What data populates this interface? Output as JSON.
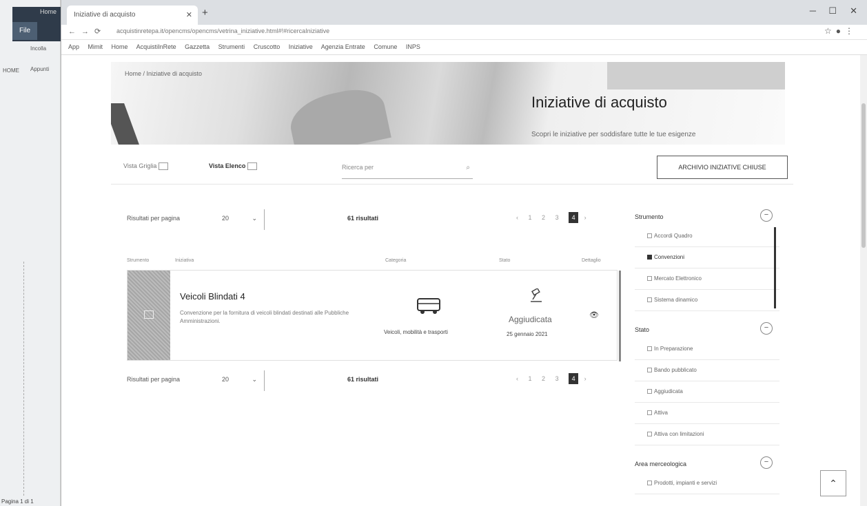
{
  "left_app": {
    "file_tab": "File",
    "home_tab": "Home",
    "side_texts": [
      "Incolla",
      "Appunti",
      "HOME"
    ],
    "status": "Pagina 1 di 1"
  },
  "browser": {
    "tab_title": "Iniziative di acquisto",
    "url": "acquistinretepa.it/opencms/opencms/vetrina_iniziative.html#!#ricercaIniziative",
    "bookmarks": [
      "App",
      "Mimit",
      "Home",
      "AcquistiInRete",
      "Gazzetta",
      "Strumenti",
      "Cruscotto",
      "Iniziative",
      "Agenzia Entrate",
      "Comune",
      "INPS"
    ]
  },
  "page": {
    "breadcrumb": "Home / Iniziative di acquisto",
    "hero_title": "Iniziative di acquisto",
    "hero_subtitle": "Scopri le iniziative per soddisfare tutte le tue esigenze",
    "view_grid_label": "Vista Griglia",
    "view_list_label": "Vista Elenco",
    "search_placeholder": "Ricerca per",
    "archive_button": "ARCHIVIO INIZIATIVE CHIUSE",
    "results_per_page_label": "Risultati per pagina",
    "results_per_page_value": "20",
    "results_count": "61 risultati",
    "pagination": [
      "1",
      "2",
      "3",
      "4"
    ],
    "current_page": "4",
    "columns": [
      "Strumento",
      "Iniziativa",
      "Categoria",
      "Stato",
      "Dettaglio"
    ]
  },
  "card": {
    "title": "Veicoli Blindati 4",
    "description": "Convenzione per la fornitura di veicoli blindati destinati alle Pubbliche Amministrazioni.",
    "category": "Veicoli, mobilità e trasporti",
    "state": "Aggiudicata",
    "date": "25 gennaio 2021"
  },
  "filters": {
    "strumento_title": "Strumento",
    "strumento_items": [
      {
        "label": "Accordi Quadro",
        "checked": false
      },
      {
        "label": "Convenzioni",
        "checked": true
      },
      {
        "label": "Mercato Elettronico",
        "checked": false
      },
      {
        "label": "Sistema dinamico",
        "checked": false
      }
    ],
    "stato_title": "Stato",
    "stato_items": [
      {
        "label": "In Preparazione",
        "checked": false
      },
      {
        "label": "Bando pubblicato",
        "checked": false
      },
      {
        "label": "Aggiudicata",
        "checked": false
      },
      {
        "label": "Attiva",
        "checked": false
      },
      {
        "label": "Attiva con limitazioni",
        "checked": false
      }
    ],
    "area_title": "Area merceologica",
    "area_first_item": "Prodotti, impianti e servizi"
  },
  "colors": {
    "accent": "#333333",
    "hero_text": "#222222"
  }
}
